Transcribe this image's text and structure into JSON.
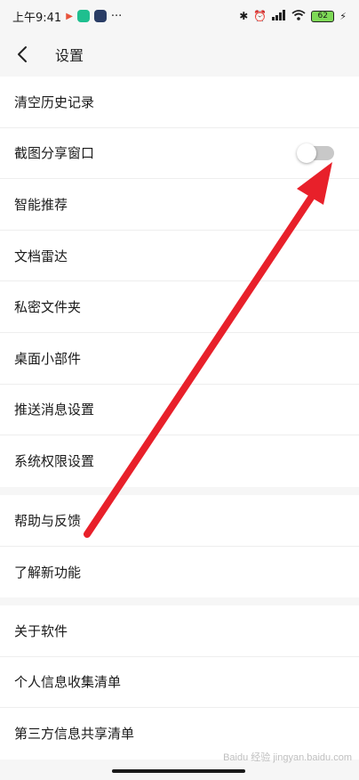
{
  "status_bar": {
    "time": "上午9:41",
    "more": "···",
    "battery": "62"
  },
  "header": {
    "title": "设置"
  },
  "sections": [
    {
      "items": [
        {
          "label": "清空历史记录"
        },
        {
          "label": "截图分享窗口",
          "toggle": false
        },
        {
          "label": "智能推荐"
        },
        {
          "label": "文档雷达"
        },
        {
          "label": "私密文件夹"
        },
        {
          "label": "桌面小部件"
        },
        {
          "label": "推送消息设置"
        },
        {
          "label": "系统权限设置"
        }
      ]
    },
    {
      "items": [
        {
          "label": "帮助与反馈"
        },
        {
          "label": "了解新功能"
        }
      ]
    },
    {
      "items": [
        {
          "label": "关于软件"
        },
        {
          "label": "个人信息收集清单"
        },
        {
          "label": "第三方信息共享清单"
        }
      ]
    }
  ],
  "colors": {
    "arrow": "#e8202a",
    "toggle_off": "#c8c8c8",
    "background": "#f6f6f6"
  },
  "watermark": "Baidu 经验 jingyan.baidu.com"
}
